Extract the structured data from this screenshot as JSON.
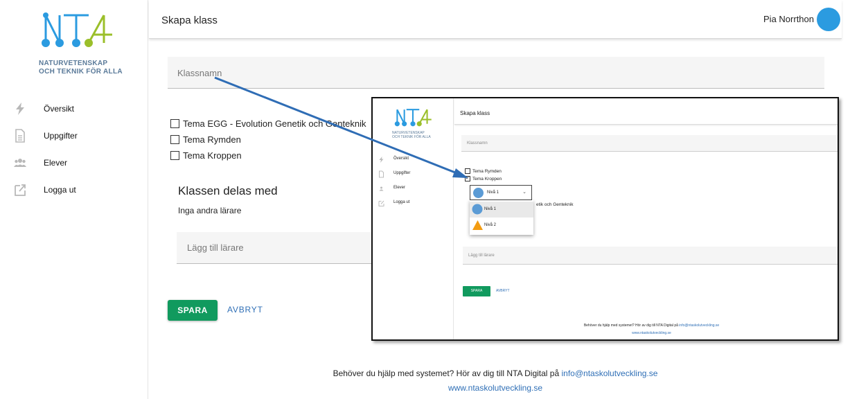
{
  "sidebar": {
    "logo_text": "NTA",
    "tagline_1": "NATURVETENSKAP",
    "tagline_2": "OCH TEKNIK FÖR ALLA",
    "items": [
      {
        "label": "Översikt",
        "icon": "lightning-icon"
      },
      {
        "label": "Uppgifter",
        "icon": "document-icon"
      },
      {
        "label": "Elever",
        "icon": "people-icon"
      },
      {
        "label": "Logga ut",
        "icon": "external-link-icon"
      }
    ]
  },
  "header": {
    "title": "Skapa klass",
    "user_name": "Pia Norrthon"
  },
  "form": {
    "class_name_placeholder": "Klassnamn",
    "themes": [
      {
        "label": "Tema EGG - Evolution Genetik och Genteknik",
        "checked": false
      },
      {
        "label": "Tema Rymden",
        "checked": false
      },
      {
        "label": "Tema Kroppen",
        "checked": false
      }
    ],
    "shared_title": "Klassen delas med",
    "shared_none": "Inga andra lärare",
    "add_teacher_placeholder": "Lägg till lärare",
    "save_label": "SPARA",
    "cancel_label": "AVBRYT"
  },
  "footer": {
    "help_text": "Behöver du hjälp med systemet? Hör av dig till NTA Digital på ",
    "email": "info@ntaskolutveckling.se",
    "website": "www.ntaskolutveckling.se"
  },
  "inset": {
    "title": "Skapa klass",
    "class_name_placeholder": "Klassnamn",
    "theme_1": "Tema Rymden",
    "theme_2": "Tema Kroppen",
    "theme_2_checked": true,
    "selected_level": "Nivå 1",
    "options": [
      "Nivå 1",
      "Nivå 2"
    ],
    "partial_text": "etik och Genteknik",
    "add_teacher_placeholder": "Lägg till lärare",
    "save_label": "SPARA",
    "cancel_label": "AVBRYT",
    "nav": [
      "Översikt",
      "Uppgifter",
      "Elever",
      "Logga ut"
    ],
    "footer_help": "Behöver du hjälp med systemet? Hör av dig till NTA Digital på ",
    "footer_email": "info@ntaskolutveckling.se",
    "footer_web": "www.ntaskolutveckling.se"
  },
  "colors": {
    "brand_blue": "#2b9be0",
    "brand_green": "#9bbf2a",
    "save_green": "#119a5e",
    "link_blue": "#2f6fb6",
    "arrow_blue": "#2f6db5"
  }
}
